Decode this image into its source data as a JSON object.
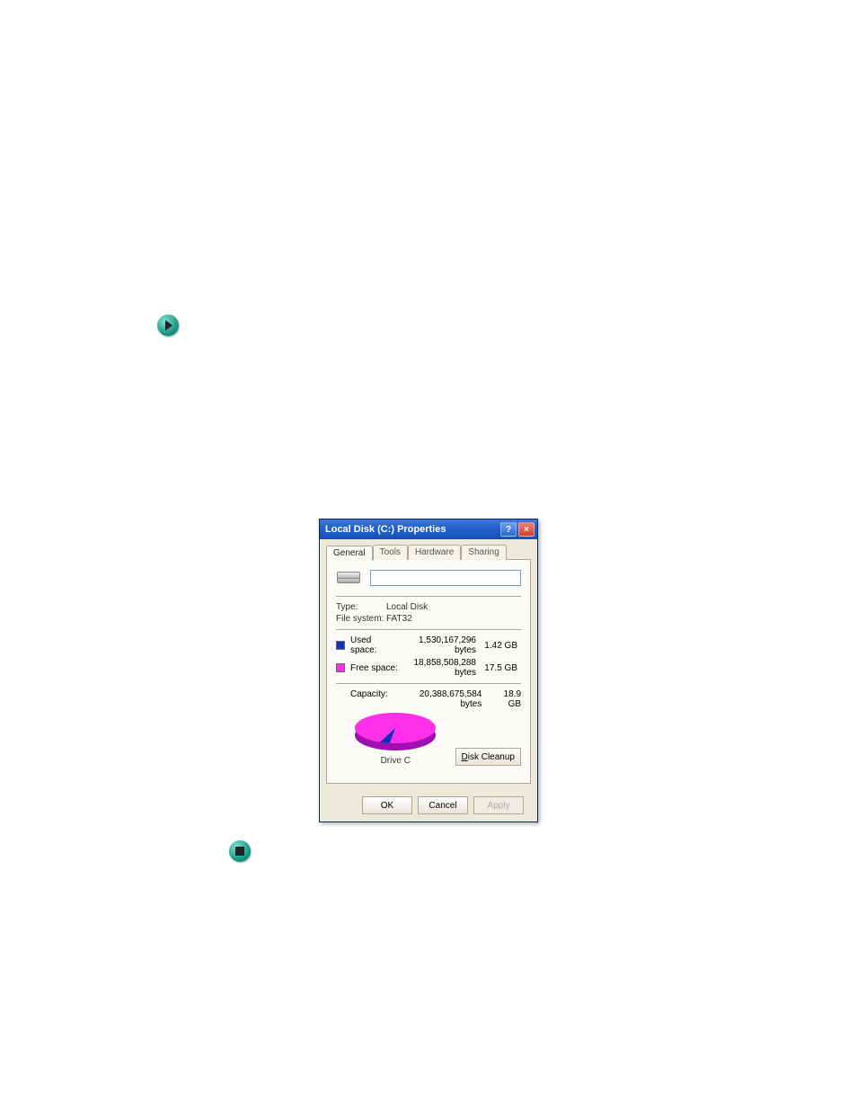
{
  "icons": {
    "play": "play-icon",
    "stop": "stop-icon"
  },
  "dialog": {
    "title": "Local Disk (C:) Properties",
    "help_label": "?",
    "close_label": "×",
    "tabs": {
      "general": "General",
      "tools": "Tools",
      "hardware": "Hardware",
      "sharing": "Sharing"
    },
    "name_value": "",
    "type_label": "Type:",
    "type_value": "Local Disk",
    "fs_label": "File system:",
    "fs_value": "FAT32",
    "used_label": "Used space:",
    "used_bytes": "1,530,167,296 bytes",
    "used_gb": "1.42 GB",
    "free_label": "Free space:",
    "free_bytes": "18,858,508,288 bytes",
    "free_gb": "17.5 GB",
    "capacity_label": "Capacity:",
    "capacity_bytes": "20,388,675,584 bytes",
    "capacity_gb": "18.9 GB",
    "drive_label": "Drive C",
    "cleanup_prefix": "D",
    "cleanup_rest": "isk Cleanup",
    "ok_label": "OK",
    "cancel_label": "Cancel",
    "apply_label": "Apply"
  },
  "chart_data": {
    "type": "pie",
    "title": "Drive C",
    "series": [
      {
        "name": "Used space",
        "value": 1530167296,
        "display": "1.42 GB",
        "color": "#1030c0"
      },
      {
        "name": "Free space",
        "value": 18858508288,
        "display": "17.5 GB",
        "color": "#ff2ee8"
      }
    ],
    "total": {
      "label": "Capacity",
      "value": 20388675584,
      "display": "18.9 GB"
    }
  }
}
